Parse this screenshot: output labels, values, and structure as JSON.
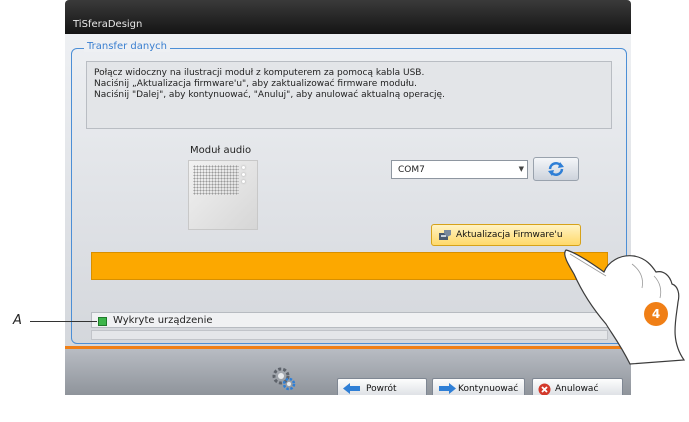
{
  "window": {
    "title": "TiSferaDesign"
  },
  "group": {
    "label": "Transfer danych"
  },
  "info": {
    "lines": [
      "Połącz widoczny na ilustracji moduł z komputerem za pomocą kabla USB.",
      "Naciśnij „Aktualizacja firmware'u\", aby zaktualizować firmware modułu.",
      "Naciśnij \"Dalej\", aby kontynuować, \"Anuluj\", aby anulować aktualną operację."
    ]
  },
  "module": {
    "label": "Moduł audio"
  },
  "port": {
    "selected": "COM7"
  },
  "firmware_button": {
    "label": "Aktualizacja Firmware'u"
  },
  "status": {
    "text": "Wykryte urządzenie",
    "led_color": "#3db54a"
  },
  "footer": {
    "back_label": "Powrót",
    "next_label": "Kontynuować",
    "cancel_label": "Anulować"
  },
  "annotations": {
    "callout_label": "A",
    "step_number": "4"
  },
  "colors": {
    "accent": "#f07f16",
    "progress": "#fca800",
    "group_border": "#4c8fd6"
  },
  "icons": {
    "refresh": "refresh-icon",
    "firmware": "firmware-icon",
    "back": "arrow-left-icon",
    "next": "arrow-right-icon",
    "cancel": "cancel-icon",
    "gear": "gear-icon"
  }
}
